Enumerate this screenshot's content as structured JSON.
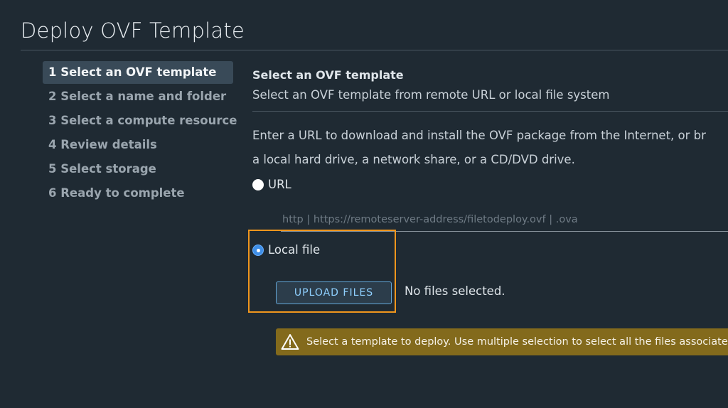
{
  "page": {
    "title": "Deploy OVF Template"
  },
  "steps": [
    {
      "label": "1 Select an OVF template",
      "active": true
    },
    {
      "label": "2 Select a name and folder",
      "active": false
    },
    {
      "label": "3 Select a compute resource",
      "active": false
    },
    {
      "label": "4 Review details",
      "active": false
    },
    {
      "label": "5 Select storage",
      "active": false
    },
    {
      "label": "6 Ready to complete",
      "active": false
    }
  ],
  "section": {
    "title": "Select an OVF template",
    "subtitle": "Select an OVF template from remote URL or local file system",
    "description_line1": "Enter a URL to download and install the OVF package from the Internet, or br",
    "description_line2": "a local hard drive, a network share, or a CD/DVD drive."
  },
  "source": {
    "url_option_label": "URL",
    "url_selected": false,
    "url_placeholder": "http | https://remoteserver-address/filetodeploy.ovf | .ova",
    "url_value": "",
    "local_option_label": "Local file",
    "local_selected": true,
    "upload_button_label": "UPLOAD FILES",
    "file_status": "No files selected."
  },
  "alert": {
    "icon": "warning-icon",
    "text": "Select a template to deploy. Use multiple selection to select all the files associated with the OVF template."
  },
  "colors": {
    "background": "#1f2a33",
    "active_step": "#394a58",
    "highlight": "#f0961d",
    "alert_background": "#836a1c",
    "button_text": "#8fd0ff",
    "radio_checked": "#3f8fe8"
  }
}
